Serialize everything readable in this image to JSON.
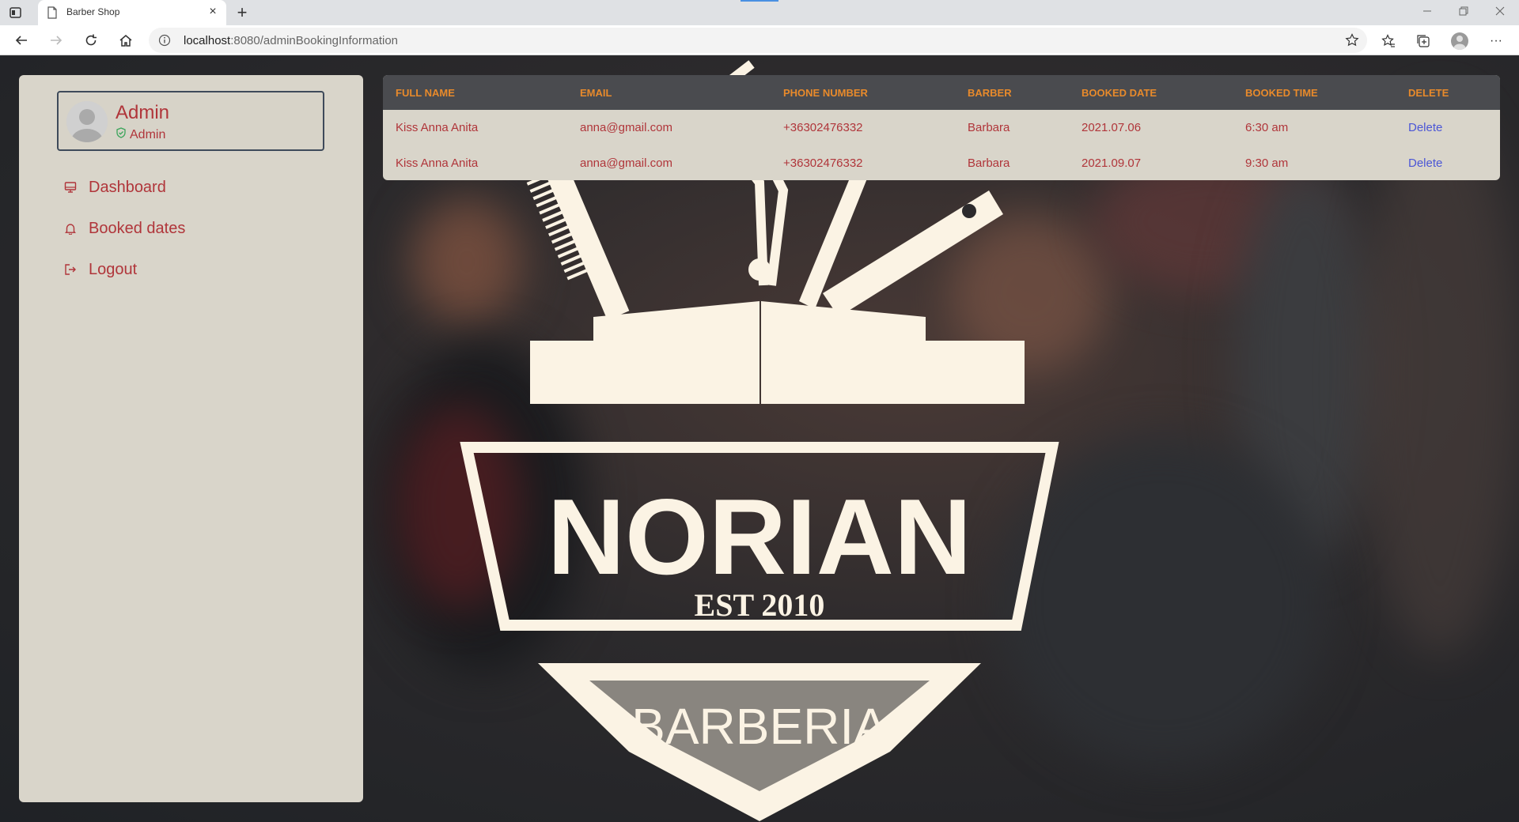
{
  "browser": {
    "tab_title": "Barber Shop",
    "new_tab_label": "+",
    "close_label": "×",
    "url_host": "localhost",
    "url_rest": ":8080/adminBookingInformation",
    "more_label": "···"
  },
  "sidebar": {
    "profile": {
      "name": "Admin",
      "role": "Admin"
    },
    "items": [
      {
        "label": "Dashboard",
        "icon": "monitor-icon"
      },
      {
        "label": "Booked dates",
        "icon": "bell-icon"
      },
      {
        "label": "Logout",
        "icon": "logout-icon"
      }
    ]
  },
  "table": {
    "headers": [
      "FULL NAME",
      "EMAIL",
      "PHONE NUMBER",
      "BARBER",
      "BOOKED DATE",
      "BOOKED TIME",
      "DELETE"
    ],
    "rows": [
      {
        "full_name": "Kiss Anna Anita",
        "email": "anna@gmail.com",
        "phone": "+36302476332",
        "barber": "Barbara",
        "date": "2021.07.06",
        "time": "6:30 am",
        "action": "Delete"
      },
      {
        "full_name": "Kiss Anna Anita",
        "email": "anna@gmail.com",
        "phone": "+36302476332",
        "barber": "Barbara",
        "date": "2021.09.07",
        "time": "9:30 am",
        "action": "Delete"
      }
    ]
  },
  "logo": {
    "name": "NORIAN",
    "established": "EST 2010",
    "subtitle": "BARBERIA"
  },
  "colors": {
    "accent_red": "#b0353a",
    "header_orange": "#e88a2b",
    "link_blue": "#4b56d6",
    "panel_bg": "#d9d5ca",
    "logo_cream": "#fbf3e4"
  }
}
